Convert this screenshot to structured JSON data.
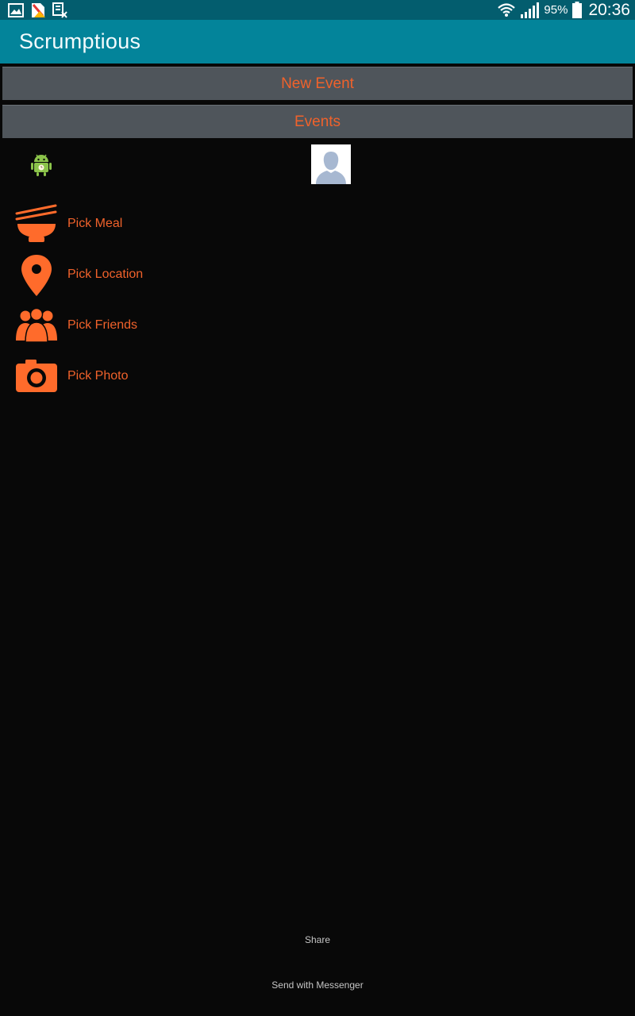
{
  "status_bar": {
    "battery_percent": "95%",
    "time": "20:36",
    "notification_icons": [
      "gallery-icon",
      "no-sim-warning-icon",
      "screenshot-doc-icon"
    ],
    "system_icons": [
      "wifi-icon",
      "signal-icon",
      "battery-icon"
    ]
  },
  "action_bar": {
    "title": "Scrumptious"
  },
  "buttons": {
    "new_event": "New Event",
    "events": "Events"
  },
  "profile": {
    "icon": "android-icon",
    "avatar": "profile-picture"
  },
  "menu": [
    {
      "icon": "bowl-chopsticks-icon",
      "label": "Pick Meal"
    },
    {
      "icon": "location-pin-icon",
      "label": "Pick Location"
    },
    {
      "icon": "friends-icon",
      "label": "Pick Friends"
    },
    {
      "icon": "camera-icon",
      "label": "Pick Photo"
    }
  ],
  "footer": {
    "share": "Share",
    "send_with_messenger": "Send with Messenger"
  },
  "colors": {
    "status_bar": "#035d6e",
    "action_bar": "#03849a",
    "button_bg": "#4f555b",
    "accent": "#f0622b",
    "icon_orange": "#ff6b2b",
    "background": "#080808"
  }
}
